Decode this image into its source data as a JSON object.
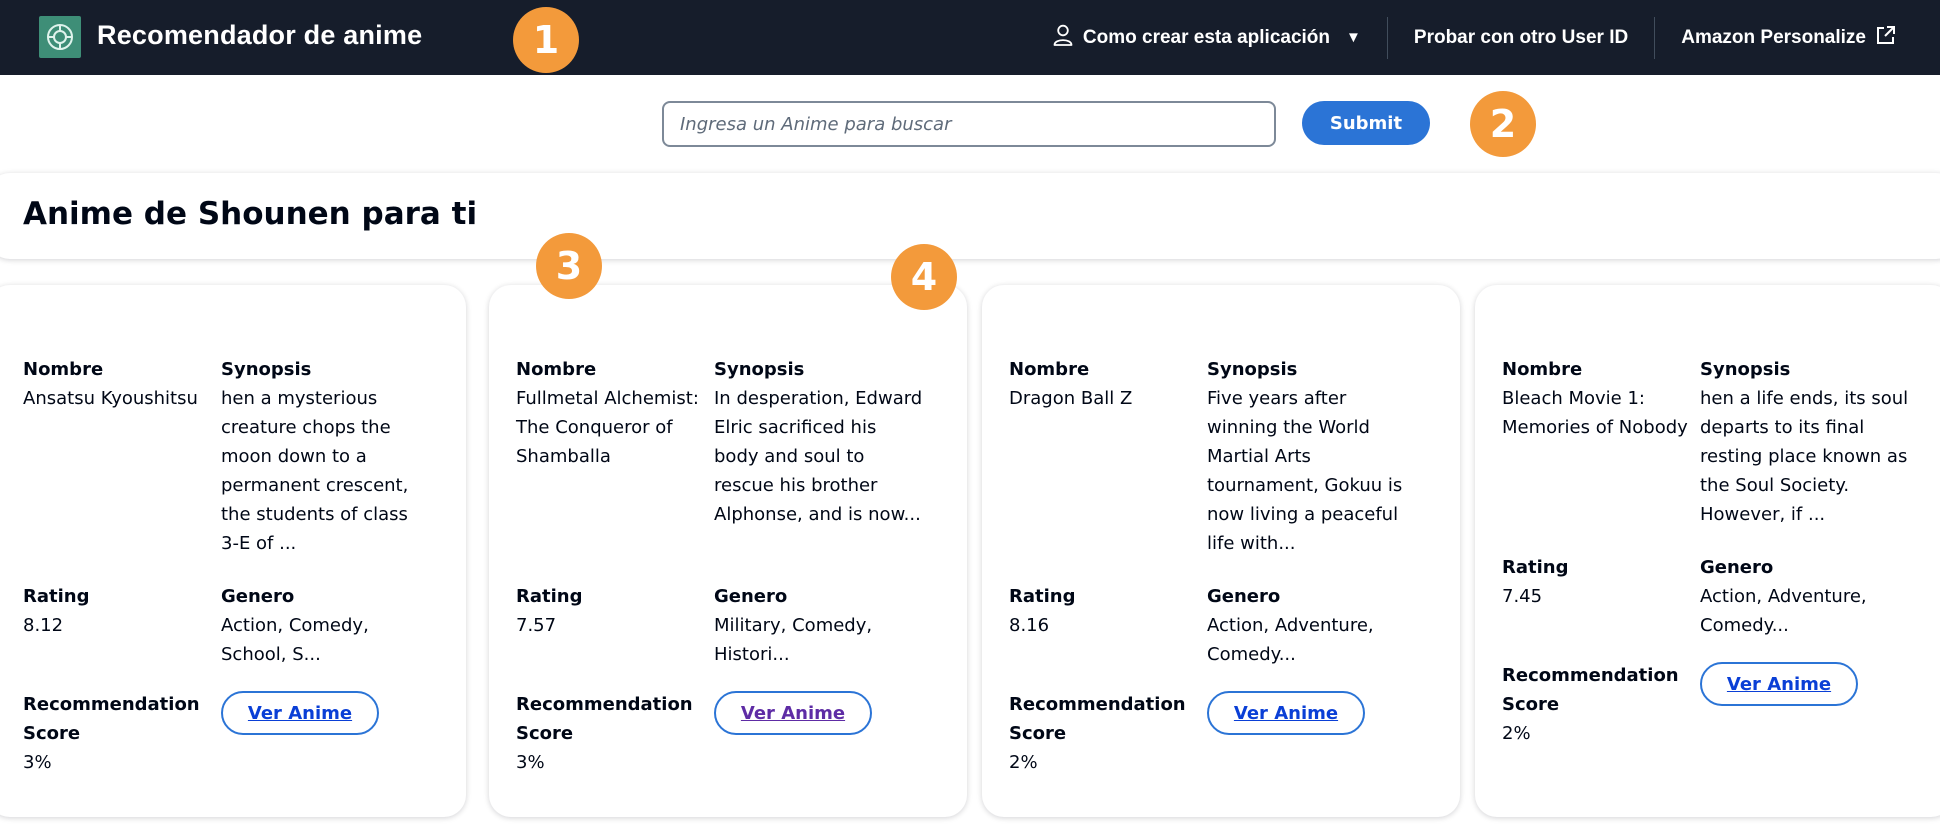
{
  "header": {
    "title": "Recomendador de anime",
    "nav": [
      {
        "label": "Como crear esta aplicación",
        "icon": "user-icon",
        "dropdown": true
      },
      {
        "label": "Probar con otro User ID"
      },
      {
        "label": "Amazon Personalize",
        "icon": "external-link-icon"
      }
    ]
  },
  "markers": [
    "1",
    "2",
    "3",
    "4"
  ],
  "search": {
    "placeholder": "Ingresa un Anime para buscar",
    "value": "",
    "submit_label": "Submit"
  },
  "section": {
    "title": "Anime de Shounen para ti"
  },
  "labels": {
    "nombre": "Nombre",
    "synopsis": "Synopsis",
    "rating": "Rating",
    "genero": "Genero",
    "recommendation_score": "Recommendation Score",
    "ver_anime": "Ver Anime"
  },
  "cards": [
    {
      "name": "Ansatsu Kyoushitsu",
      "synopsis": "hen a mysterious creature chops the moon down to a permanent crescent, the students of class 3-E of ...",
      "rating": "8.12",
      "genre": "Action, Comedy, School, S...",
      "score": "3%"
    },
    {
      "name": "Fullmetal Alchemist: The Conqueror of Shamballa",
      "synopsis": "In desperation, Edward Elric sacrificed his body and soul to rescue his brother Alphonse, and is now...",
      "rating": "7.57",
      "genre": "Military, Comedy, Histori...",
      "score": "3%"
    },
    {
      "name": "Dragon Ball Z",
      "synopsis": "Five years after winning the World Martial Arts tournament, Gokuu is now living a peaceful life with...",
      "rating": "8.16",
      "genre": "Action, Adventure, Comedy...",
      "score": "2%"
    },
    {
      "name": "Bleach Movie 1: Memories of Nobody",
      "synopsis": "hen a life ends, its soul departs to its final resting place known as the Soul Society. However, if ...",
      "rating": "7.45",
      "genre": "Action, Adventure, Comedy...",
      "score": "2%"
    }
  ],
  "colors": {
    "nav_bg": "#161d2b",
    "accent": "#2b74d6",
    "marker": "#f39a3b",
    "logo": "#3e8e77"
  }
}
